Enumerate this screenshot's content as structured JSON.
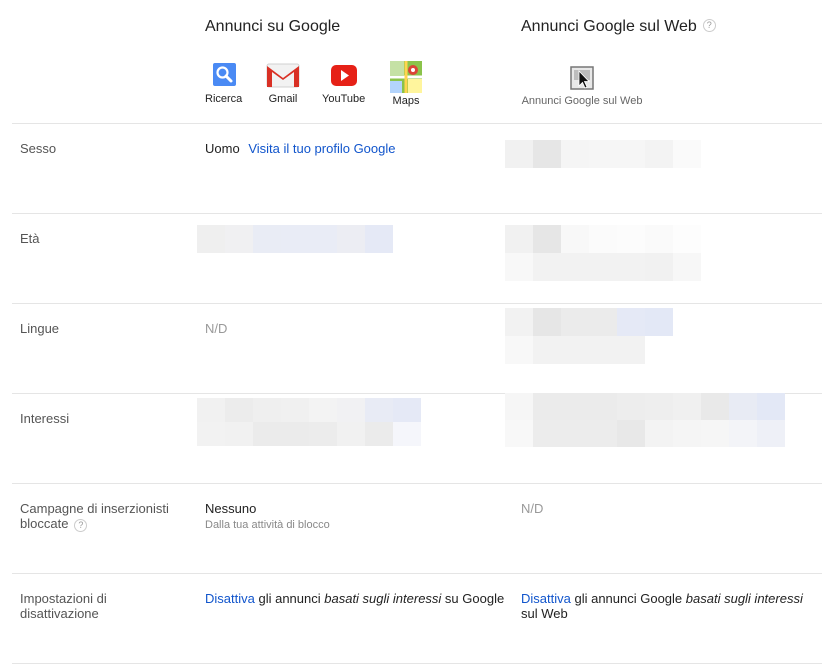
{
  "columns": {
    "google": {
      "title": "Annunci su Google"
    },
    "web": {
      "title": "Annunci Google sul Web",
      "help": "?"
    }
  },
  "products": [
    {
      "label": "Ricerca",
      "icon": "search-icon"
    },
    {
      "label": "Gmail",
      "icon": "gmail-icon"
    },
    {
      "label": "YouTube",
      "icon": "youtube-icon"
    },
    {
      "label": "Maps",
      "icon": "maps-icon"
    }
  ],
  "web_product": {
    "label": "Annunci Google sul Web",
    "icon": "web-ads-icon"
  },
  "rows": {
    "sesso": {
      "label": "Sesso",
      "google_value": "Uomo",
      "google_link": "Visita il tuo profilo Google"
    },
    "eta": {
      "label": "Età"
    },
    "lingue": {
      "label": "Lingue",
      "google_value": "N/D"
    },
    "interessi": {
      "label": "Interessi"
    },
    "campagne": {
      "label_line1": "Campagne di inserzionisti",
      "label_line2": "bloccate",
      "help": "?",
      "google_value": "Nessuno",
      "google_sub": "Dalla tua attività di blocco",
      "web_value": "N/D"
    },
    "impostazioni": {
      "label_line1": "Impostazioni di",
      "label_line2": "disattivazione",
      "google_link": "Disattiva",
      "google_text1": " gli annunci ",
      "google_em": "basati sugli interessi",
      "google_text2": " su Google",
      "web_link": "Disattiva",
      "web_text1": " gli annunci Google ",
      "web_em": "basati sugli interessi",
      "web_text2": "sul Web"
    }
  },
  "colors": {
    "link": "#1155cc",
    "divider": "#e5e5e5",
    "pixel_light": "#f0f0f0",
    "pixel_blue": "#e6eaf6"
  }
}
